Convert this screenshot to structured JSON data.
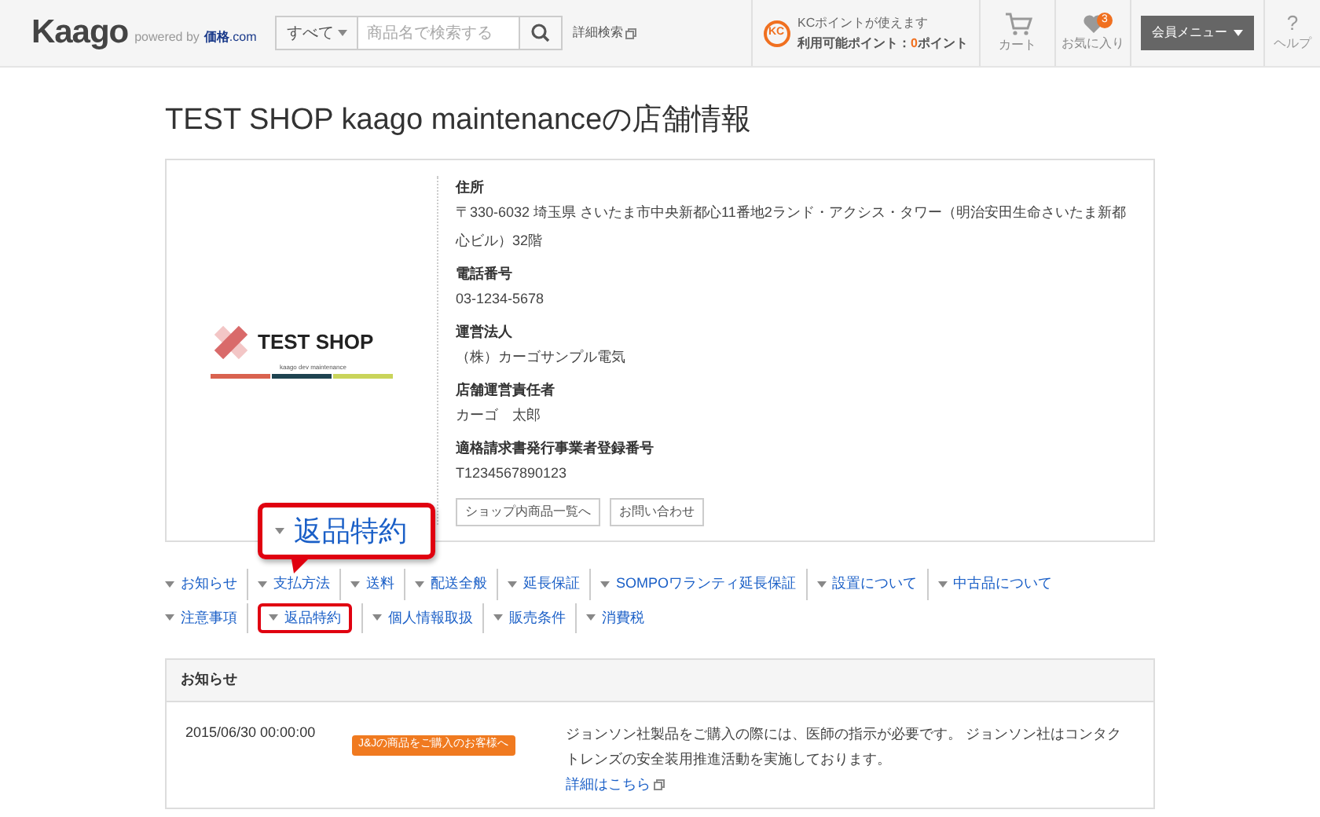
{
  "header": {
    "logo": "Kaago",
    "powered_by": "powered by",
    "powered_brand_1": "価格",
    "powered_brand_2": ".com",
    "search_category": "すべて",
    "search": {
      "placeholder": "商品名で検索する"
    },
    "advanced_search": "詳細検索",
    "points_badge": "KC",
    "points_title": "KCポイントが使えます",
    "points_label": "利用可能ポイント：",
    "points_value": "0",
    "points_unit": "ポイント",
    "cart": "カート",
    "favorites": "お気に入り",
    "favorites_count": "3",
    "member_menu": "会員メニュー",
    "help_icon": "?",
    "help": "ヘルプ"
  },
  "page_title": "TEST SHOP kaago maintenanceの店舗情報",
  "shop": {
    "logo_text": "TEST SHOP",
    "logo_sub": "kaago dev maintenance",
    "fields": [
      {
        "label": "住所",
        "value": "〒330-6032 埼玉県 さいたま市中央新都心11番地2ランド・アクシス・タワー（明治安田生命さいたま新都心ビル）32階"
      },
      {
        "label": "電話番号",
        "value": "03-1234-5678"
      },
      {
        "label": "運営法人",
        "value": "（株）カーゴサンプル電気"
      },
      {
        "label": "店舗運営責任者",
        "value": "カーゴ　太郎"
      },
      {
        "label": "適格請求書発行事業者登録番号",
        "value": "T1234567890123"
      }
    ],
    "buttons": [
      "ショップ内商品一覧へ",
      "お問い合わせ"
    ]
  },
  "callout": {
    "text": "返品特約"
  },
  "nav_rows": [
    [
      {
        "label": "お知らせ",
        "highlighted": false
      },
      {
        "label": "支払方法",
        "highlighted": false
      },
      {
        "label": "送料",
        "highlighted": false
      },
      {
        "label": "配送全般",
        "highlighted": false
      },
      {
        "label": "延長保証",
        "highlighted": false
      },
      {
        "label": "SOMPOワランティ延長保証",
        "highlighted": false
      },
      {
        "label": "設置について",
        "highlighted": false
      },
      {
        "label": "中古品について",
        "highlighted": false
      }
    ],
    [
      {
        "label": "注意事項",
        "highlighted": false
      },
      {
        "label": "返品特約",
        "highlighted": true
      },
      {
        "label": "個人情報取扱",
        "highlighted": false
      },
      {
        "label": "販売条件",
        "highlighted": false
      },
      {
        "label": "消費税",
        "highlighted": false
      }
    ]
  ],
  "notices": {
    "title": "お知らせ",
    "items": [
      {
        "date": "2015/06/30 00:00:00",
        "tag": "J&Jの商品をご購入のお客様へ",
        "text": "ジョンソン社製品をご購入の際には、医師の指示が必要です。 ジョンソン社はコンタクトレンズの安全装用推進活動を実施しております。",
        "link": "詳細はこちら"
      }
    ]
  }
}
